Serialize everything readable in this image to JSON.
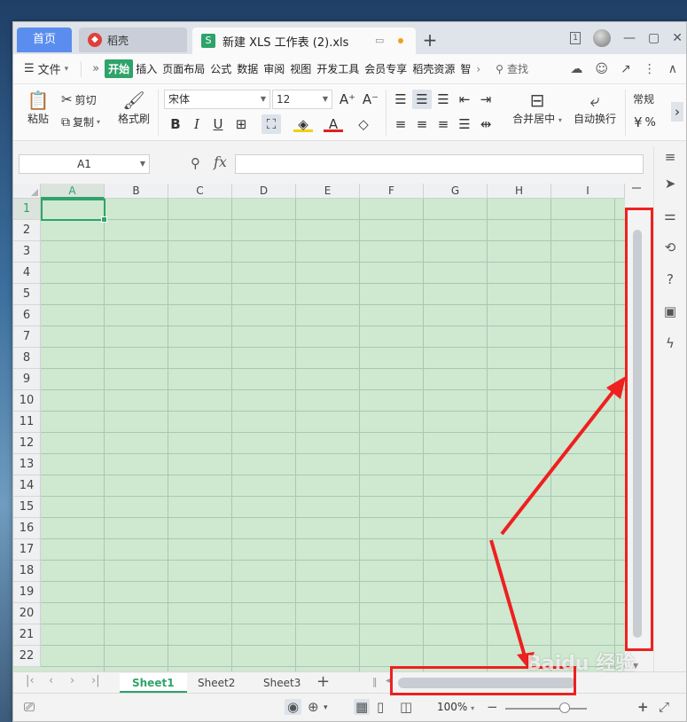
{
  "tabs": {
    "home_label": "首页",
    "doc_label": "稻壳",
    "active_label": "新建 XLS 工作表 (2).xls",
    "add_label": "+"
  },
  "window_controls": {
    "badge": "1",
    "minimize": "—",
    "restore": "▢",
    "close": "✕"
  },
  "menu": {
    "file_label": "文件",
    "more_label": "»",
    "items": [
      "开始",
      "插入",
      "页面布局",
      "公式",
      "数据",
      "审阅",
      "视图",
      "开发工具",
      "会员专享",
      "稻壳资源",
      "智"
    ],
    "active_index": 0,
    "search_label": "查找"
  },
  "ribbon": {
    "paste": "粘贴",
    "cut": "剪切",
    "copy": "复制",
    "format_painter": "格式刷",
    "font_name": "宋体",
    "font_size": "12",
    "merge_center": "合并居中",
    "wrap_text": "自动换行",
    "number_format": "常规"
  },
  "formula_bar": {
    "cell_ref": "A1",
    "fx_label": "fx",
    "formula_value": ""
  },
  "grid": {
    "columns": [
      "A",
      "B",
      "C",
      "D",
      "E",
      "F",
      "G",
      "H",
      "I"
    ],
    "rows": [
      "1",
      "2",
      "3",
      "4",
      "5",
      "6",
      "7",
      "8",
      "9",
      "10",
      "11",
      "12",
      "13",
      "14",
      "15",
      "16",
      "17",
      "18",
      "19",
      "20",
      "21",
      "22"
    ],
    "selected_cell": "A1",
    "cell_fill_color": "#cfe8d0",
    "accent_color": "#2ea36a"
  },
  "sheets": {
    "tabs": [
      "Sheet1",
      "Sheet2",
      "Sheet3"
    ],
    "active_index": 0,
    "add_label": "+"
  },
  "status": {
    "zoom_label": "100%",
    "zoom_minus": "−",
    "zoom_plus": "+"
  },
  "annotations": {
    "color": "#ee2020",
    "watermark_text": "Baidu 经验"
  }
}
